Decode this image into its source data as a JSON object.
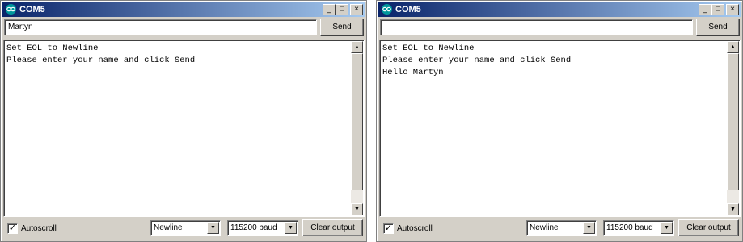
{
  "left": {
    "title": "COM5",
    "input_value": "Martyn",
    "send_label": "Send",
    "output_lines": [
      "Set EOL to Newline",
      "Please enter your name and click Send"
    ],
    "autoscroll_label": "Autoscroll",
    "autoscroll_checked": true,
    "line_ending": "Newline",
    "baud": "115200 baud",
    "clear_label": "Clear output"
  },
  "right": {
    "title": "COM5",
    "input_value": "",
    "send_label": "Send",
    "output_lines": [
      "Set EOL to Newline",
      "Please enter your name and click Send",
      "Hello Martyn"
    ],
    "autoscroll_label": "Autoscroll",
    "autoscroll_checked": true,
    "line_ending": "Newline",
    "baud": "115200 baud",
    "clear_label": "Clear output"
  },
  "caption_buttons": {
    "minimize": "_",
    "maximize": "□",
    "close": "×"
  },
  "icons": {
    "app": "arduino-infinity-icon",
    "dropdown": "triangle-down-icon",
    "scroll_up": "triangle-up-icon",
    "scroll_down": "triangle-down-icon",
    "check": "check-icon"
  },
  "colors": {
    "title_start": "#0a246a",
    "title_end": "#a6caf0",
    "app_icon": "#00979c",
    "chrome": "#d4d0c8"
  }
}
